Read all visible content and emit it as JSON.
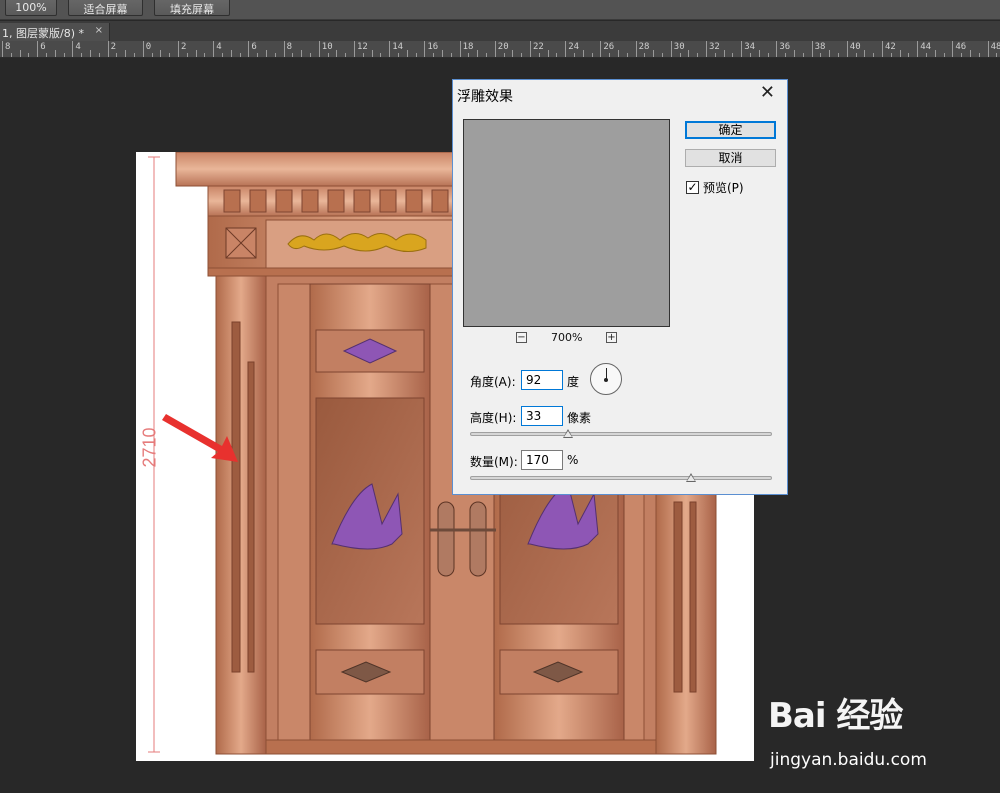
{
  "options_bar": {
    "buttons": [
      {
        "label": "100%"
      },
      {
        "label": "适合屏幕"
      },
      {
        "label": "填充屏幕"
      }
    ]
  },
  "document_tab": {
    "title": "1, 图层蒙版/8) *",
    "close_glyph": "×"
  },
  "ruler": {
    "labels": [
      "8",
      "6",
      "4",
      "2",
      "0",
      "2",
      "4",
      "6",
      "8",
      "10",
      "12",
      "14",
      "16",
      "18",
      "20",
      "22",
      "24",
      "26",
      "28",
      "30",
      "32",
      "34",
      "36",
      "38",
      "40",
      "42",
      "44",
      "46",
      "48"
    ]
  },
  "canvas": {
    "dimension_label": "2710",
    "artwork": "copper-double-door"
  },
  "emboss_dialog": {
    "title": "浮雕效果",
    "close_glyph": "✕",
    "ok_label": "确定",
    "cancel_label": "取消",
    "preview_checkbox": {
      "label": "预览(P)",
      "checked": true,
      "glyph": "✓"
    },
    "zoom": {
      "value": "700%",
      "minus": "−",
      "plus": "+"
    },
    "angle": {
      "label": "角度(A):",
      "value": "92",
      "unit": "度"
    },
    "height": {
      "label": "高度(H):",
      "value": "33",
      "unit": "像素",
      "slider_level": 0.32
    },
    "amount": {
      "label": "数量(M):",
      "value": "170",
      "unit": "%",
      "slider_level": 0.73
    },
    "preview_color": "#9e9e9e"
  },
  "annotations": {
    "arrow_color": "#e8312e",
    "arrow_count": 2
  },
  "watermark": {
    "logo": "Bai 经验",
    "url": "jingyan.baidu.com"
  }
}
